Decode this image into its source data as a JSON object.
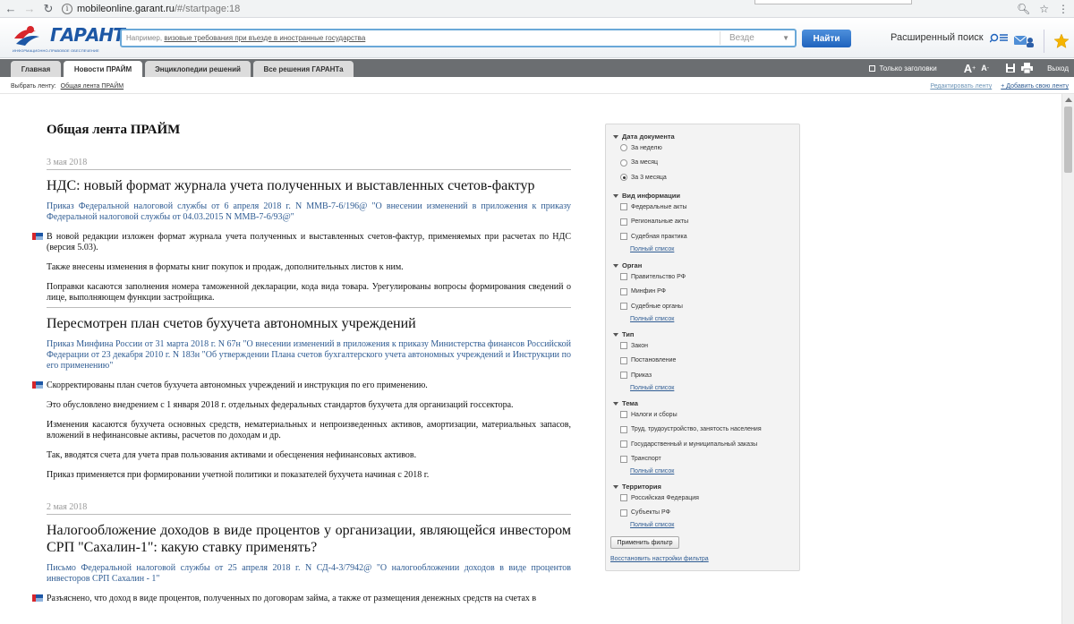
{
  "browser": {
    "url_host": "mobileonline.garant.ru",
    "url_path": "/#/startpage:18"
  },
  "header": {
    "logo_text": "ГАРАНТ",
    "logo_subtitle": "ИНФОРМАЦИОННО-ПРАВОВОЕ ОБЕСПЕЧЕНИЕ",
    "search_hint_prefix": "Например,",
    "search_hint_example": "визовые требования при въезде в иностранные государства",
    "search_scope": "Везде",
    "find_label": "Найти",
    "advanced_search_label": "Расширенный поиск"
  },
  "tabs": [
    {
      "label": "Главная"
    },
    {
      "label": "Новости ПРАЙМ"
    },
    {
      "label": "Энциклопедии решений"
    },
    {
      "label": "Все решения ГАРАНТа"
    }
  ],
  "tabs_right": {
    "headings_only": "Только заголовки",
    "font_large": "A",
    "font_small": "A",
    "logout": "Выход"
  },
  "feed_bar": {
    "choose_label": "Выбрать ленту:",
    "current_feed": "Общая лента ПРАЙМ",
    "edit_feed": "Редактировать ленту",
    "add_feed": "+ Добавить свою ленту"
  },
  "main": {
    "feed_title": "Общая лента ПРАЙМ",
    "date1": "3 мая 2018",
    "date2": "2 мая 2018",
    "articles": [
      {
        "title": "НДС: новый формат журнала учета полученных и выставленных счетов-фактур",
        "link": "Приказ Федеральной налоговой службы от 6 апреля 2018 г. N ММВ-7-6/196@ \"О внесении изменений в приложения к приказу Федеральной налоговой службы от 04.03.2015 N ММВ-7-6/93@\"",
        "p1": "В новой редакции изложен формат журнала учета полученных и выставленных счетов-фактур, применяемых при расчетах по НДС (версия 5.03).",
        "p2": "Также внесены изменения в форматы книг покупок и продаж, дополнительных листов к ним.",
        "p3": "Поправки касаются заполнения номера таможенной декларации, кода вида товара. Урегулированы вопросы формирования сведений о лице, выполняющем функции застройщика."
      },
      {
        "title": "Пересмотрен план счетов бухучета автономных учреждений",
        "link": "Приказ Минфина России от 31 марта 2018 г. N 67н \"О внесении изменений в приложения к приказу Министерства финансов Российской Федерации от 23 декабря 2010 г. N 183н \"Об утверждении Плана счетов бухгалтерского учета автономных учреждений и Инструкции по его применению\"",
        "p1": "Скорректированы план счетов бухучета автономных учреждений и инструкция по его применению.",
        "p2": "Это обусловлено внедрением с 1 января 2018 г. отдельных федеральных стандартов бухучета для организаций госсектора.",
        "p3": "Изменения касаются бухучета основных средств, нематериальных и непроизведенных активов, амортизации, материальных запасов, вложений в нефинансовые активы, расчетов по доходам и др.",
        "p4": "Так, вводятся счета для учета прав пользования активами и обесценения нефинансовых активов.",
        "p5": "Приказ применяется при формировании учетной политики и показателей бухучета начиная с 2018 г."
      },
      {
        "title": "Налогообложение доходов в виде процентов у организации, являющейся инвестором СРП \"Сахалин-1\": какую ставку применять?",
        "link": "Письмо Федеральной налоговой службы от 25 апреля 2018 г. N СД-4-3/7942@ \"О налогообложении доходов в виде процентов инвесторов СРП Сахалин - 1\"",
        "p1": "Разъяснено, что доход в виде процентов, полученных по договорам займа, а также от размещения денежных средств на счетах в"
      }
    ]
  },
  "filter": {
    "groups": [
      {
        "title": "Дата документа",
        "type": "radio",
        "options": [
          "За неделю",
          "За месяц",
          "За 3 месяца"
        ],
        "selected": 2
      },
      {
        "title": "Вид информации",
        "type": "check",
        "options": [
          "Федеральные акты",
          "Региональные акты",
          "Судебная практика"
        ],
        "more": "Полный список"
      },
      {
        "title": "Орган",
        "type": "check",
        "options": [
          "Правительство РФ",
          "Минфин РФ",
          "Судебные органы"
        ],
        "more": "Полный список"
      },
      {
        "title": "Тип",
        "type": "check",
        "options": [
          "Закон",
          "Постановление",
          "Приказ"
        ],
        "more": "Полный список"
      },
      {
        "title": "Тема",
        "type": "check",
        "options": [
          "Налоги и сборы",
          "Труд, трудоустройство, занятость населения",
          "Государственный и муниципальный заказы",
          "Транспорт"
        ],
        "more": "Полный список"
      },
      {
        "title": "Территория",
        "type": "check",
        "options": [
          "Российская Федерация",
          "Субъекты РФ"
        ],
        "more": "Полный список"
      }
    ],
    "apply_label": "Применить фильтр",
    "reset_label": "Восстановить настройки фильтра"
  },
  "colors": {
    "accent": "#1f63bd",
    "link": "#2f5c93",
    "tabs_bar": "#6b6e71"
  }
}
